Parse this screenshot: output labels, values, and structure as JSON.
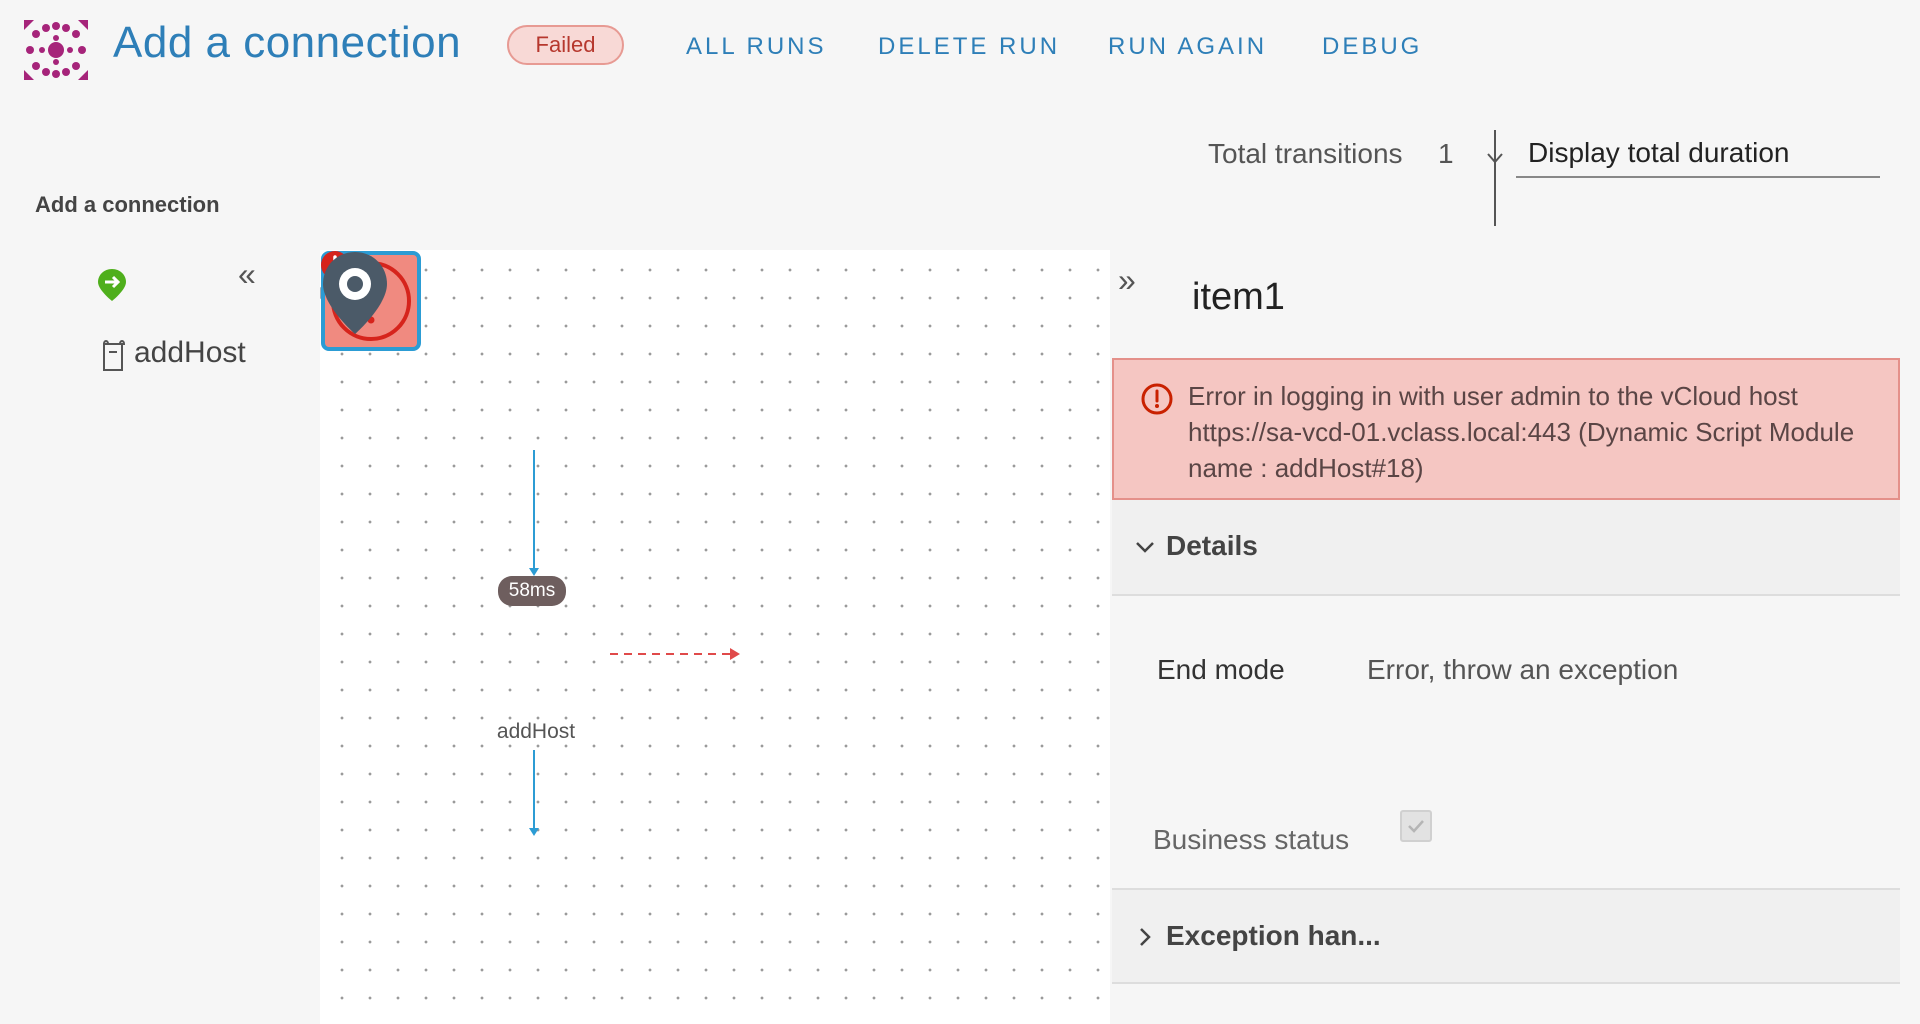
{
  "header": {
    "title": "Add a connection",
    "status": "Failed",
    "actions": [
      "ALL RUNS",
      "DELETE RUN",
      "RUN AGAIN",
      "DEBUG"
    ]
  },
  "toolbar": {
    "total_transitions_label": "Total transitions",
    "total_transitions_value": "1",
    "duration_select": "Display total duration"
  },
  "breadcrumb": "Add a connection",
  "tree": {
    "items": [
      {
        "label": "addHost",
        "icon": "script-icon"
      }
    ]
  },
  "canvas": {
    "task_duration": "58ms",
    "task_label": "addHost"
  },
  "panel": {
    "title": "item1",
    "error": "Error in logging in with user admin to the vCloud host https://sa-vcd-01.vclass.local:443 (Dynamic Script Module name : addHost#18)",
    "details_label": "Details",
    "end_mode_label": "End mode",
    "end_mode_value": "Error, throw an exception",
    "business_status_label": "Business status",
    "exception_label": "Exception han..."
  },
  "colors": {
    "accent": "#2e7fb8",
    "start_green": "#4faf1c",
    "error_red": "#d6241c",
    "end_gray": "#4b5a68"
  }
}
